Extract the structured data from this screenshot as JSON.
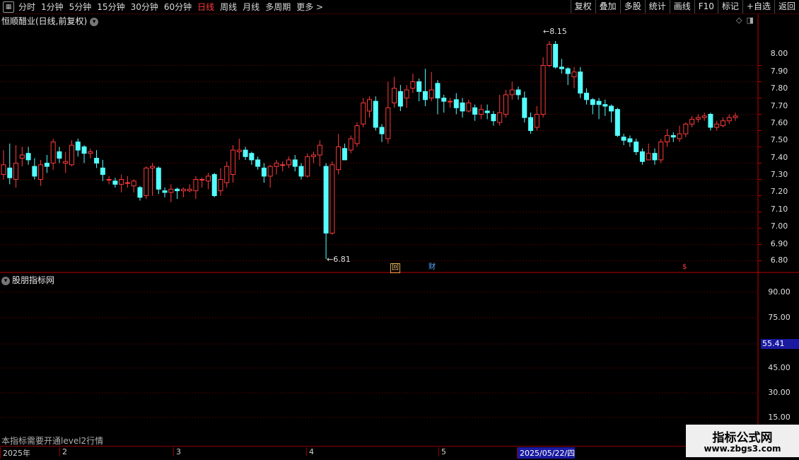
{
  "toolbar": {
    "periods": [
      "分时",
      "1分钟",
      "5分钟",
      "15分钟",
      "30分钟",
      "60分钟",
      "日线",
      "周线",
      "月线",
      "多周期",
      "更多 >"
    ],
    "active_period": "日线",
    "right_buttons": [
      "复权",
      "叠加",
      "多股",
      "统计",
      "画线",
      "F10",
      "标记",
      "+自选",
      "返回"
    ]
  },
  "header": {
    "title": "恒顺醋业(日线,前复权)",
    "circle_icon": "chevron-down-icon"
  },
  "price_axis": [
    "8.00",
    "7.90",
    "7.80",
    "7.70",
    "7.60",
    "7.50",
    "7.40",
    "7.30",
    "7.20",
    "7.10",
    "7.00",
    "6.90",
    "6.80"
  ],
  "annotations": {
    "high": "8.15",
    "low": "6.81"
  },
  "markers": {
    "hui": "回",
    "cai": "财",
    "ss": "$"
  },
  "indicator": {
    "title": "股朋指标网",
    "axis": [
      "90.00",
      "75.00",
      "45.00",
      "30.00",
      "15.00"
    ],
    "value": "55.41",
    "notice": "本指标需要开通level2行情"
  },
  "timebar": [
    "2025年",
    "2",
    "3",
    "4",
    "5",
    "2025/05/22/四"
  ],
  "watermark": {
    "top": "指标公式网",
    "bottom": "www.zbgs3.com"
  },
  "colors": {
    "up": "#ff3b3b",
    "down": "#54ffff",
    "grid": "#7a0000"
  },
  "chart_data": {
    "type": "candlestick",
    "ylim": [
      6.75,
      8.25
    ],
    "candles": [
      [
        7.33,
        7.39,
        7.48,
        7.3
      ],
      [
        7.37,
        7.31,
        7.52,
        7.27
      ],
      [
        7.3,
        7.4,
        7.51,
        7.25
      ],
      [
        7.43,
        7.45,
        7.5,
        7.38
      ],
      [
        7.46,
        7.42,
        7.5,
        7.39
      ],
      [
        7.38,
        7.32,
        7.43,
        7.3
      ],
      [
        7.3,
        7.39,
        7.42,
        7.26
      ],
      [
        7.4,
        7.38,
        7.45,
        7.34
      ],
      [
        7.4,
        7.53,
        7.55,
        7.36
      ],
      [
        7.47,
        7.43,
        7.5,
        7.4
      ],
      [
        7.4,
        7.41,
        7.47,
        7.34
      ],
      [
        7.39,
        7.51,
        7.54,
        7.38
      ],
      [
        7.53,
        7.48,
        7.55,
        7.44
      ],
      [
        7.5,
        7.46,
        7.51,
        7.4
      ],
      [
        7.46,
        7.47,
        7.49,
        7.43
      ],
      [
        7.43,
        7.4,
        7.48,
        7.37
      ],
      [
        7.37,
        7.33,
        7.42,
        7.29
      ],
      [
        7.3,
        7.3,
        7.32,
        7.27
      ],
      [
        7.29,
        7.27,
        7.31,
        7.25
      ],
      [
        7.27,
        7.3,
        7.33,
        7.22
      ],
      [
        7.28,
        7.28,
        7.32,
        7.25
      ],
      [
        7.26,
        7.29,
        7.3,
        7.22
      ],
      [
        7.25,
        7.19,
        7.26,
        7.17
      ],
      [
        7.2,
        7.37,
        7.38,
        7.18
      ],
      [
        7.37,
        7.38,
        7.4,
        7.2
      ],
      [
        7.37,
        7.24,
        7.38,
        7.21
      ],
      [
        7.23,
        7.22,
        7.25,
        7.19
      ],
      [
        7.22,
        7.24,
        7.27,
        7.16
      ],
      [
        7.24,
        7.23,
        7.25,
        7.18
      ],
      [
        7.23,
        7.24,
        7.25,
        7.19
      ],
      [
        7.23,
        7.24,
        7.27,
        7.22
      ],
      [
        7.23,
        7.3,
        7.32,
        7.18
      ],
      [
        7.3,
        7.3,
        7.31,
        7.25
      ],
      [
        7.29,
        7.32,
        7.34,
        7.24
      ],
      [
        7.33,
        7.2,
        7.34,
        7.19
      ],
      [
        7.23,
        7.3,
        7.37,
        7.2
      ],
      [
        7.28,
        7.38,
        7.41,
        7.25
      ],
      [
        7.33,
        7.48,
        7.51,
        7.28
      ],
      [
        7.47,
        7.48,
        7.55,
        7.42
      ],
      [
        7.48,
        7.44,
        7.5,
        7.42
      ],
      [
        7.46,
        7.42,
        7.47,
        7.39
      ],
      [
        7.42,
        7.38,
        7.44,
        7.36
      ],
      [
        7.37,
        7.32,
        7.4,
        7.28
      ],
      [
        7.32,
        7.38,
        7.39,
        7.25
      ],
      [
        7.38,
        7.4,
        7.42,
        7.33
      ],
      [
        7.39,
        7.39,
        7.41,
        7.35
      ],
      [
        7.39,
        7.42,
        7.44,
        7.37
      ],
      [
        7.42,
        7.38,
        7.45,
        7.35
      ],
      [
        7.38,
        7.32,
        7.4,
        7.3
      ],
      [
        7.32,
        7.44,
        7.46,
        7.31
      ],
      [
        7.44,
        7.45,
        7.47,
        7.4
      ],
      [
        7.45,
        7.51,
        7.54,
        7.38
      ],
      [
        7.38,
        6.97,
        7.4,
        6.81
      ],
      [
        6.97,
        7.39,
        7.41,
        6.96
      ],
      [
        7.36,
        7.5,
        7.58,
        7.33
      ],
      [
        7.49,
        7.42,
        7.52,
        7.42
      ],
      [
        7.48,
        7.55,
        7.57,
        7.46
      ],
      [
        7.52,
        7.63,
        7.65,
        7.5
      ],
      [
        7.64,
        7.77,
        7.8,
        7.62
      ],
      [
        7.72,
        7.79,
        7.81,
        7.68
      ],
      [
        7.78,
        7.62,
        7.81,
        7.6
      ],
      [
        7.62,
        7.58,
        7.64,
        7.53
      ],
      [
        7.55,
        7.74,
        7.9,
        7.52
      ],
      [
        7.77,
        7.86,
        7.93,
        7.74
      ],
      [
        7.84,
        7.75,
        7.88,
        7.72
      ],
      [
        7.8,
        7.85,
        7.88,
        7.74
      ],
      [
        7.86,
        7.9,
        7.95,
        7.83
      ],
      [
        7.9,
        7.84,
        7.92,
        7.78
      ],
      [
        7.84,
        7.79,
        7.98,
        7.75
      ],
      [
        7.8,
        7.85,
        7.96,
        7.78
      ],
      [
        7.89,
        7.8,
        7.91,
        7.7
      ],
      [
        7.8,
        7.78,
        7.82,
        7.71
      ],
      [
        7.78,
        7.78,
        7.8,
        7.74
      ],
      [
        7.79,
        7.74,
        7.83,
        7.7
      ],
      [
        7.77,
        7.72,
        7.8,
        7.68
      ],
      [
        7.72,
        7.77,
        7.79,
        7.71
      ],
      [
        7.74,
        7.7,
        7.76,
        7.66
      ],
      [
        7.7,
        7.73,
        7.76,
        7.67
      ],
      [
        7.72,
        7.71,
        7.76,
        7.67
      ],
      [
        7.7,
        7.66,
        7.72,
        7.63
      ],
      [
        7.65,
        7.71,
        7.82,
        7.63
      ],
      [
        7.7,
        7.82,
        7.85,
        7.68
      ],
      [
        7.82,
        7.85,
        7.9,
        7.79
      ],
      [
        7.85,
        7.82,
        7.87,
        7.79
      ],
      [
        7.8,
        7.68,
        7.84,
        7.65
      ],
      [
        7.68,
        7.6,
        7.71,
        7.58
      ],
      [
        7.62,
        7.7,
        7.75,
        7.6
      ],
      [
        7.7,
        8.0,
        8.05,
        7.68
      ],
      [
        8.0,
        8.13,
        8.15,
        7.99
      ],
      [
        8.13,
        7.99,
        8.15,
        7.98
      ],
      [
        7.99,
        7.98,
        8.04,
        7.95
      ],
      [
        7.98,
        7.95,
        7.99,
        7.88
      ],
      [
        7.93,
        7.96,
        7.99,
        7.86
      ],
      [
        7.96,
        7.83,
        7.99,
        7.8
      ],
      [
        7.83,
        7.79,
        7.86,
        7.76
      ],
      [
        7.79,
        7.76,
        7.8,
        7.7
      ],
      [
        7.78,
        7.76,
        7.8,
        7.67
      ],
      [
        7.76,
        7.75,
        7.79,
        7.69
      ],
      [
        7.75,
        7.72,
        7.76,
        7.65
      ],
      [
        7.73,
        7.57,
        7.74,
        7.56
      ],
      [
        7.56,
        7.54,
        7.58,
        7.51
      ],
      [
        7.55,
        7.53,
        7.57,
        7.5
      ],
      [
        7.53,
        7.47,
        7.55,
        7.45
      ],
      [
        7.47,
        7.41,
        7.49,
        7.39
      ],
      [
        7.42,
        7.46,
        7.52,
        7.42
      ],
      [
        7.46,
        7.42,
        7.49,
        7.39
      ],
      [
        7.42,
        7.53,
        7.55,
        7.4
      ],
      [
        7.53,
        7.57,
        7.61,
        7.5
      ],
      [
        7.57,
        7.56,
        7.59,
        7.53
      ],
      [
        7.55,
        7.58,
        7.63,
        7.53
      ],
      [
        7.58,
        7.64,
        7.65,
        7.56
      ],
      [
        7.64,
        7.67,
        7.69,
        7.62
      ],
      [
        7.67,
        7.68,
        7.7,
        7.65
      ],
      [
        7.68,
        7.69,
        7.71,
        7.66
      ],
      [
        7.7,
        7.62,
        7.71,
        7.6
      ],
      [
        7.62,
        7.64,
        7.66,
        7.6
      ],
      [
        7.63,
        7.66,
        7.68,
        7.62
      ],
      [
        7.66,
        7.68,
        7.7,
        7.64
      ],
      [
        7.68,
        7.69,
        7.71,
        7.66
      ]
    ]
  }
}
